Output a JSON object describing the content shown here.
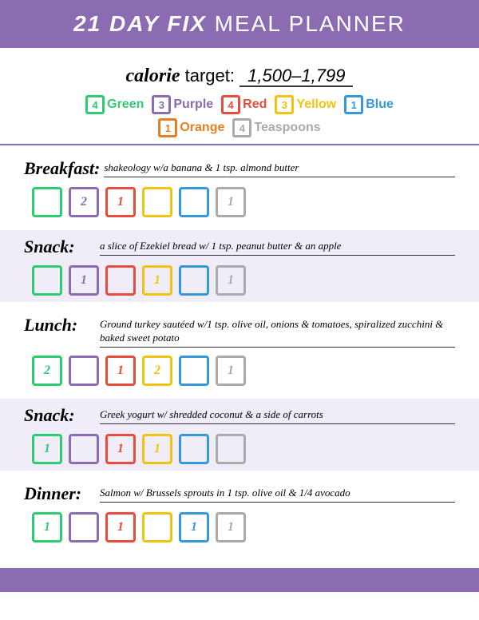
{
  "header": {
    "title_bold": "21 DAY FIX",
    "title_normal": "MEAL PLANNER"
  },
  "calorie": {
    "label_italic": "calorie",
    "label_normal": " target:",
    "value": "1,500–1,799"
  },
  "color_targets": {
    "row1": [
      {
        "count": "4",
        "color": "green",
        "label": "Green"
      },
      {
        "count": "3",
        "color": "purple",
        "label": "Purple"
      },
      {
        "count": "4",
        "color": "red",
        "label": "Red"
      },
      {
        "count": "3",
        "color": "yellow",
        "label": "Yellow"
      },
      {
        "count": "1",
        "color": "blue",
        "label": "Blue"
      }
    ],
    "row2": [
      {
        "count": "1",
        "color": "orange",
        "label": "Orange"
      },
      {
        "count": "4",
        "color": "gray",
        "label": "Teaspoons"
      }
    ]
  },
  "meals": [
    {
      "name": "Breakfast:",
      "description": "shakeology w/a banana & 1 tsp. almond butter",
      "shaded": false,
      "containers": [
        {
          "color": "green",
          "num": ""
        },
        {
          "color": "purple",
          "num": "2"
        },
        {
          "color": "red",
          "num": "1"
        },
        {
          "color": "yellow",
          "num": ""
        },
        {
          "color": "blue",
          "num": ""
        },
        {
          "color": "gray",
          "num": "1"
        }
      ]
    },
    {
      "name": "Snack:",
      "description": "a slice of Ezekiel bread w/ 1 tsp. peanut butter & an apple",
      "shaded": true,
      "containers": [
        {
          "color": "green",
          "num": ""
        },
        {
          "color": "purple",
          "num": "1"
        },
        {
          "color": "red",
          "num": ""
        },
        {
          "color": "yellow",
          "num": "1"
        },
        {
          "color": "blue",
          "num": ""
        },
        {
          "color": "gray",
          "num": "1"
        }
      ]
    },
    {
      "name": "Lunch:",
      "description": "Ground turkey sautéed w/1 tsp. olive oil, onions & tomatoes, spiralized zucchini & baked sweet potato",
      "shaded": false,
      "containers": [
        {
          "color": "green",
          "num": "2"
        },
        {
          "color": "purple",
          "num": ""
        },
        {
          "color": "red",
          "num": "1"
        },
        {
          "color": "yellow",
          "num": "2"
        },
        {
          "color": "blue",
          "num": ""
        },
        {
          "color": "gray",
          "num": "1"
        }
      ]
    },
    {
      "name": "Snack:",
      "description": "Greek yogurt w/ shredded coconut & a side of carrots",
      "shaded": true,
      "containers": [
        {
          "color": "green",
          "num": "1"
        },
        {
          "color": "purple",
          "num": ""
        },
        {
          "color": "red",
          "num": "1"
        },
        {
          "color": "yellow",
          "num": "1"
        },
        {
          "color": "blue",
          "num": ""
        },
        {
          "color": "gray",
          "num": ""
        }
      ]
    },
    {
      "name": "Dinner:",
      "description": "Salmon w/ Brussels sprouts in 1 tsp. olive oil & 1/4 avocado",
      "shaded": false,
      "containers": [
        {
          "color": "green",
          "num": "1"
        },
        {
          "color": "purple",
          "num": ""
        },
        {
          "color": "red",
          "num": "1"
        },
        {
          "color": "yellow",
          "num": ""
        },
        {
          "color": "blue",
          "num": "1"
        },
        {
          "color": "gray",
          "num": "1"
        }
      ]
    }
  ]
}
